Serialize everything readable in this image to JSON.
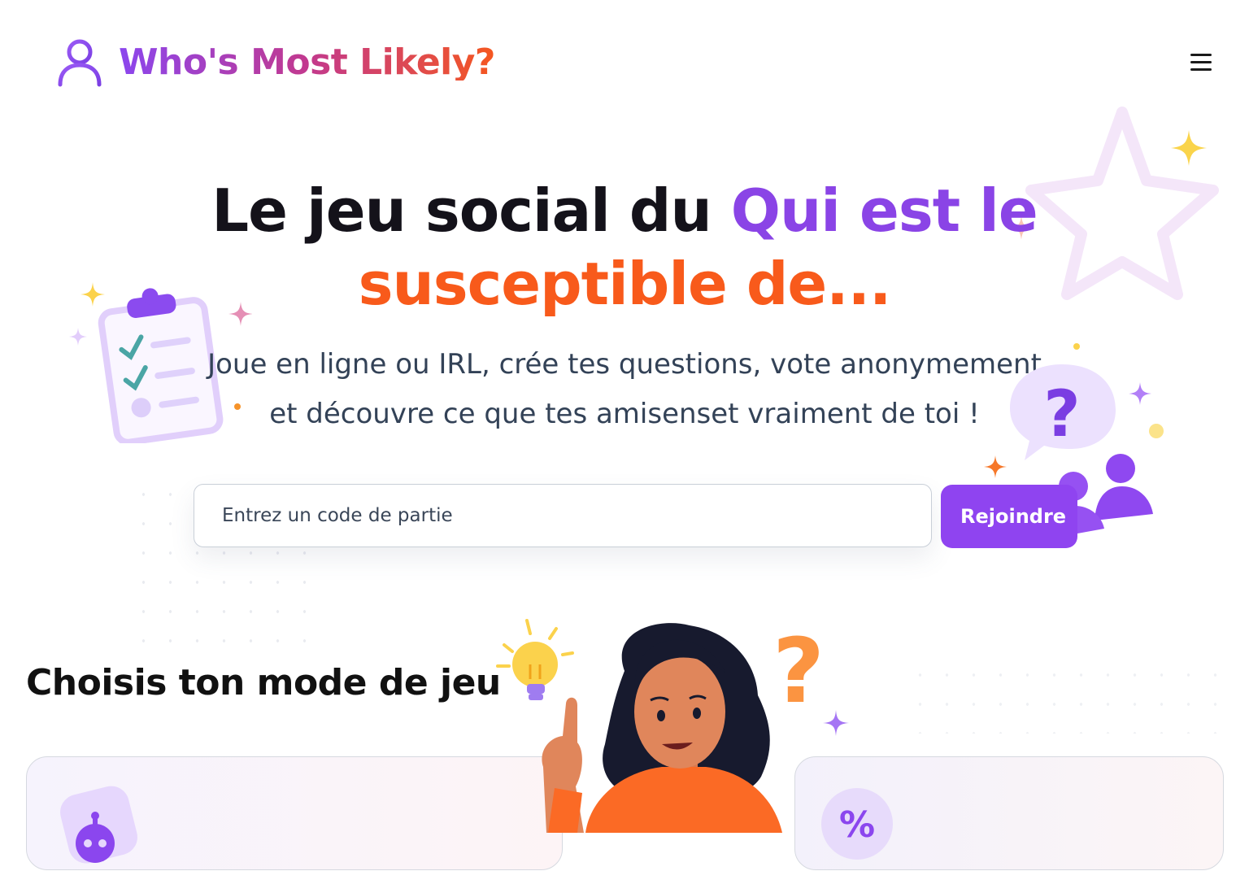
{
  "header": {
    "app_title": "Who's Most Likely?",
    "logo_icon": "user-icon",
    "menu_icon": "hamburger-menu-icon"
  },
  "hero": {
    "title_part1": "Le jeu social du ",
    "title_part2": "Qui est le",
    "title_part3": "susceptible de...",
    "subtitle_line1": "Joue en ligne ou IRL, crée tes questions, vote anonymement",
    "subtitle_line2": "et découvre ce que tes amisenset vraiment de toi !"
  },
  "join": {
    "placeholder": "Entrez un code de partie",
    "button_label": "Rejoindre"
  },
  "modes": {
    "section_title": "Choisis ton mode de jeu",
    "card_left_icon": "robot-icon",
    "card_right_icon": "percent-icon"
  },
  "colors": {
    "brand_purple": "#8a44e6",
    "brand_orange": "#f85a1b",
    "button_purple": "#8f44f0"
  }
}
